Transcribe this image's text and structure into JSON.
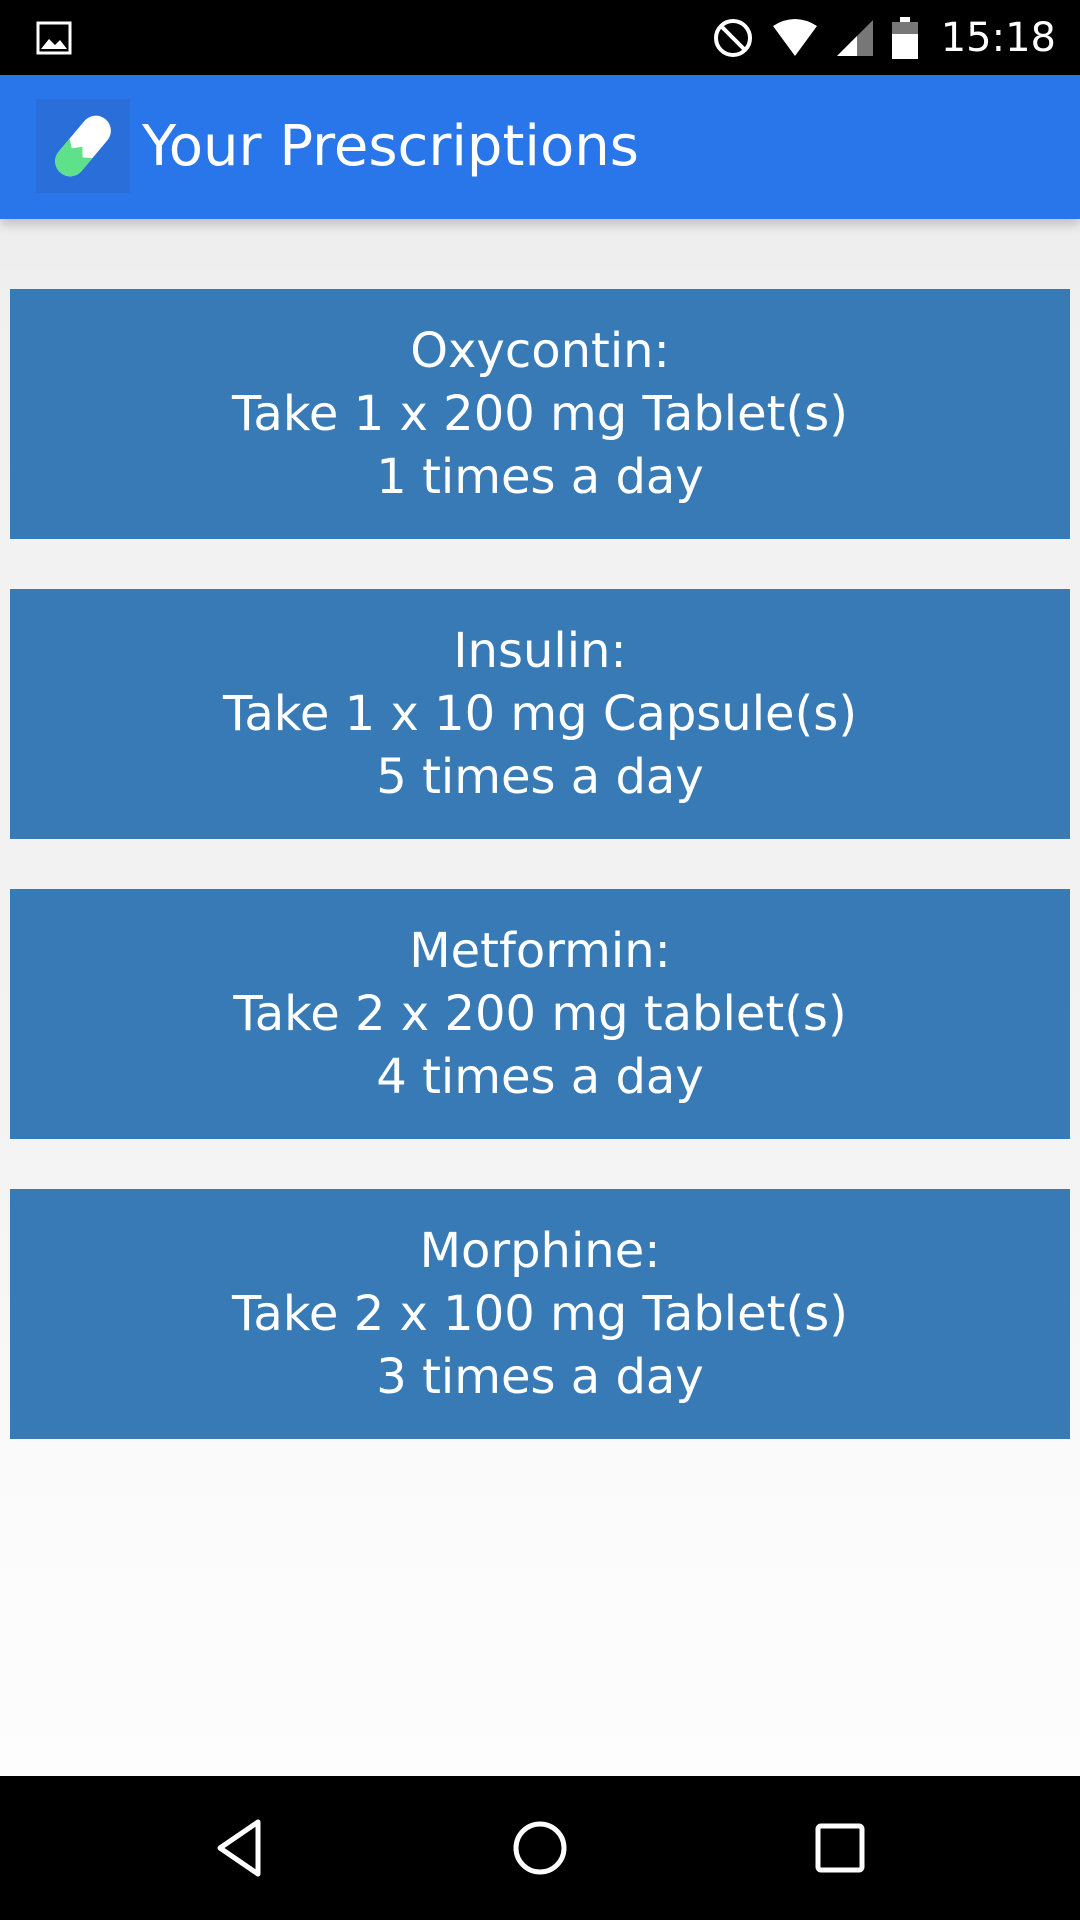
{
  "status_bar": {
    "time": "15:18",
    "icons": [
      "image-notification-icon",
      "do-not-disturb-icon",
      "wifi-icon",
      "cell-signal-icon",
      "battery-icon"
    ]
  },
  "app_bar": {
    "title": "Your Prescriptions",
    "logo_icon": "pill-capsule-icon",
    "colors": {
      "background": "#2975ea",
      "pill_green": "#5ee18a",
      "pill_white": "#ffffff"
    }
  },
  "prescriptions": [
    {
      "name": "Oxycontin:",
      "dose": "Take 1 x 200 mg Tablet(s)",
      "frequency": "1 times a day"
    },
    {
      "name": "Insulin:",
      "dose": "Take 1 x 10 mg Capsule(s)",
      "frequency": "5 times a day"
    },
    {
      "name": "Metformin:",
      "dose": "Take 2 x 200 mg tablet(s)",
      "frequency": "4 times a day"
    },
    {
      "name": "Morphine:",
      "dose": "Take 2 x 100 mg Tablet(s)",
      "frequency": "3 times a day"
    }
  ],
  "card_color": "#377ab6",
  "nav_bar": {
    "icons": [
      "back-icon",
      "home-icon",
      "recents-icon"
    ]
  }
}
